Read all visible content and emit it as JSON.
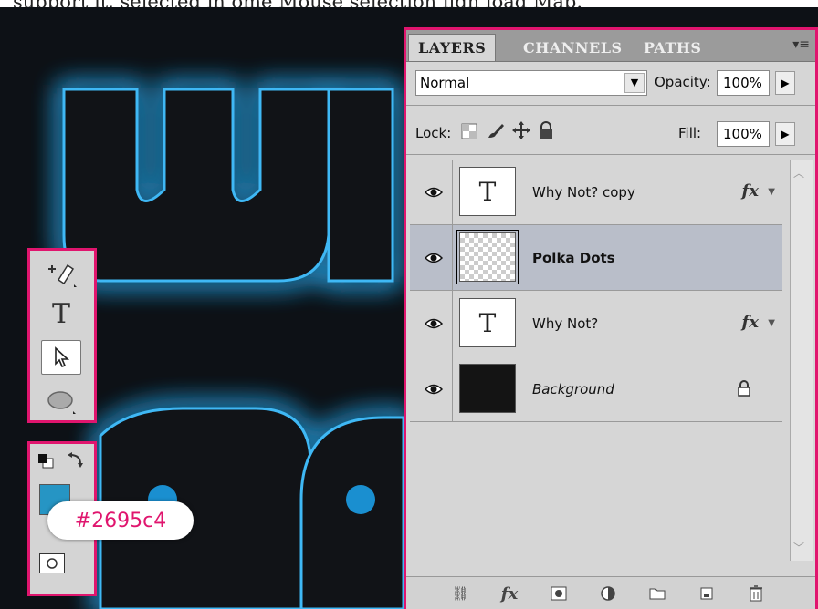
{
  "caption": "support it, selected in ome Mouse selection ligh load Map.",
  "panel": {
    "tabs": [
      "LAYERS",
      "CHANNELS",
      "PATHS"
    ],
    "blend_mode": "Normal",
    "opacity_label": "Opacity:",
    "opacity_value": "100%",
    "lock_label": "Lock:",
    "fill_label": "Fill:",
    "fill_value": "100%",
    "layers": [
      {
        "name": "Why Not? copy",
        "thumb": "T",
        "fx": "fx"
      },
      {
        "name": "Polka Dots",
        "thumb": "",
        "fx": ""
      },
      {
        "name": "Why Not?",
        "thumb": "T",
        "fx": "fx"
      },
      {
        "name": "Background",
        "thumb": "",
        "fx": ""
      }
    ]
  },
  "tools": {
    "type_tool_glyph": "T"
  },
  "color": {
    "foreground_hex": "#2695c4",
    "callout_text": "#2695c4"
  }
}
